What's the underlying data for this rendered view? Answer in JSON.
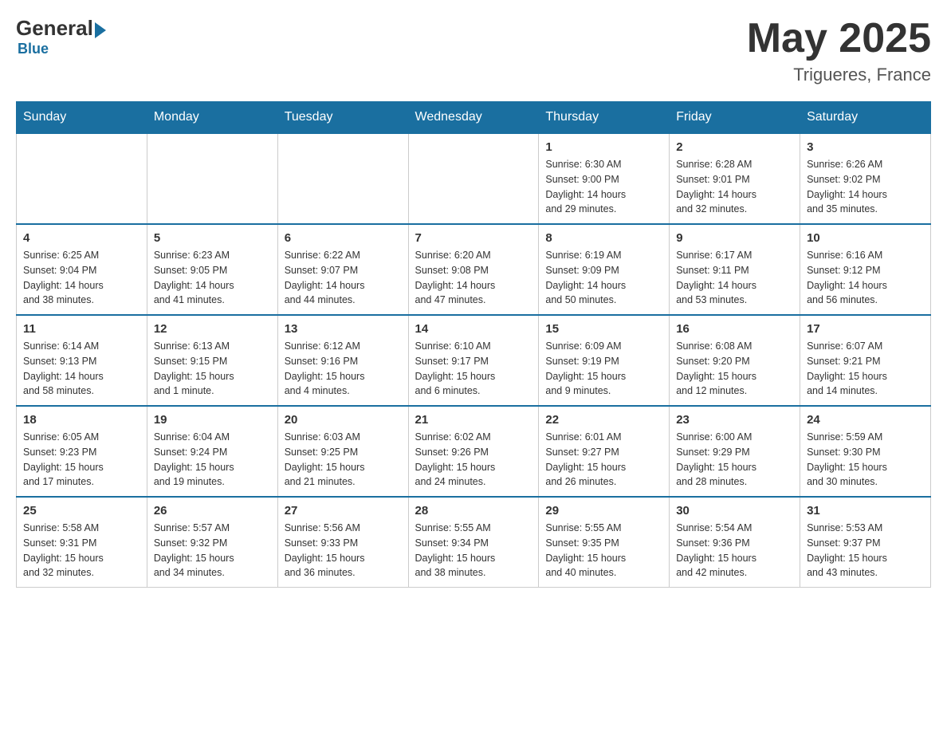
{
  "header": {
    "logo_general": "General",
    "logo_blue": "Blue",
    "month_title": "May 2025",
    "location": "Trigueres, France"
  },
  "days_of_week": [
    "Sunday",
    "Monday",
    "Tuesday",
    "Wednesday",
    "Thursday",
    "Friday",
    "Saturday"
  ],
  "weeks": [
    [
      {
        "day": "",
        "info": ""
      },
      {
        "day": "",
        "info": ""
      },
      {
        "day": "",
        "info": ""
      },
      {
        "day": "",
        "info": ""
      },
      {
        "day": "1",
        "info": "Sunrise: 6:30 AM\nSunset: 9:00 PM\nDaylight: 14 hours\nand 29 minutes."
      },
      {
        "day": "2",
        "info": "Sunrise: 6:28 AM\nSunset: 9:01 PM\nDaylight: 14 hours\nand 32 minutes."
      },
      {
        "day": "3",
        "info": "Sunrise: 6:26 AM\nSunset: 9:02 PM\nDaylight: 14 hours\nand 35 minutes."
      }
    ],
    [
      {
        "day": "4",
        "info": "Sunrise: 6:25 AM\nSunset: 9:04 PM\nDaylight: 14 hours\nand 38 minutes."
      },
      {
        "day": "5",
        "info": "Sunrise: 6:23 AM\nSunset: 9:05 PM\nDaylight: 14 hours\nand 41 minutes."
      },
      {
        "day": "6",
        "info": "Sunrise: 6:22 AM\nSunset: 9:07 PM\nDaylight: 14 hours\nand 44 minutes."
      },
      {
        "day": "7",
        "info": "Sunrise: 6:20 AM\nSunset: 9:08 PM\nDaylight: 14 hours\nand 47 minutes."
      },
      {
        "day": "8",
        "info": "Sunrise: 6:19 AM\nSunset: 9:09 PM\nDaylight: 14 hours\nand 50 minutes."
      },
      {
        "day": "9",
        "info": "Sunrise: 6:17 AM\nSunset: 9:11 PM\nDaylight: 14 hours\nand 53 minutes."
      },
      {
        "day": "10",
        "info": "Sunrise: 6:16 AM\nSunset: 9:12 PM\nDaylight: 14 hours\nand 56 minutes."
      }
    ],
    [
      {
        "day": "11",
        "info": "Sunrise: 6:14 AM\nSunset: 9:13 PM\nDaylight: 14 hours\nand 58 minutes."
      },
      {
        "day": "12",
        "info": "Sunrise: 6:13 AM\nSunset: 9:15 PM\nDaylight: 15 hours\nand 1 minute."
      },
      {
        "day": "13",
        "info": "Sunrise: 6:12 AM\nSunset: 9:16 PM\nDaylight: 15 hours\nand 4 minutes."
      },
      {
        "day": "14",
        "info": "Sunrise: 6:10 AM\nSunset: 9:17 PM\nDaylight: 15 hours\nand 6 minutes."
      },
      {
        "day": "15",
        "info": "Sunrise: 6:09 AM\nSunset: 9:19 PM\nDaylight: 15 hours\nand 9 minutes."
      },
      {
        "day": "16",
        "info": "Sunrise: 6:08 AM\nSunset: 9:20 PM\nDaylight: 15 hours\nand 12 minutes."
      },
      {
        "day": "17",
        "info": "Sunrise: 6:07 AM\nSunset: 9:21 PM\nDaylight: 15 hours\nand 14 minutes."
      }
    ],
    [
      {
        "day": "18",
        "info": "Sunrise: 6:05 AM\nSunset: 9:23 PM\nDaylight: 15 hours\nand 17 minutes."
      },
      {
        "day": "19",
        "info": "Sunrise: 6:04 AM\nSunset: 9:24 PM\nDaylight: 15 hours\nand 19 minutes."
      },
      {
        "day": "20",
        "info": "Sunrise: 6:03 AM\nSunset: 9:25 PM\nDaylight: 15 hours\nand 21 minutes."
      },
      {
        "day": "21",
        "info": "Sunrise: 6:02 AM\nSunset: 9:26 PM\nDaylight: 15 hours\nand 24 minutes."
      },
      {
        "day": "22",
        "info": "Sunrise: 6:01 AM\nSunset: 9:27 PM\nDaylight: 15 hours\nand 26 minutes."
      },
      {
        "day": "23",
        "info": "Sunrise: 6:00 AM\nSunset: 9:29 PM\nDaylight: 15 hours\nand 28 minutes."
      },
      {
        "day": "24",
        "info": "Sunrise: 5:59 AM\nSunset: 9:30 PM\nDaylight: 15 hours\nand 30 minutes."
      }
    ],
    [
      {
        "day": "25",
        "info": "Sunrise: 5:58 AM\nSunset: 9:31 PM\nDaylight: 15 hours\nand 32 minutes."
      },
      {
        "day": "26",
        "info": "Sunrise: 5:57 AM\nSunset: 9:32 PM\nDaylight: 15 hours\nand 34 minutes."
      },
      {
        "day": "27",
        "info": "Sunrise: 5:56 AM\nSunset: 9:33 PM\nDaylight: 15 hours\nand 36 minutes."
      },
      {
        "day": "28",
        "info": "Sunrise: 5:55 AM\nSunset: 9:34 PM\nDaylight: 15 hours\nand 38 minutes."
      },
      {
        "day": "29",
        "info": "Sunrise: 5:55 AM\nSunset: 9:35 PM\nDaylight: 15 hours\nand 40 minutes."
      },
      {
        "day": "30",
        "info": "Sunrise: 5:54 AM\nSunset: 9:36 PM\nDaylight: 15 hours\nand 42 minutes."
      },
      {
        "day": "31",
        "info": "Sunrise: 5:53 AM\nSunset: 9:37 PM\nDaylight: 15 hours\nand 43 minutes."
      }
    ]
  ]
}
